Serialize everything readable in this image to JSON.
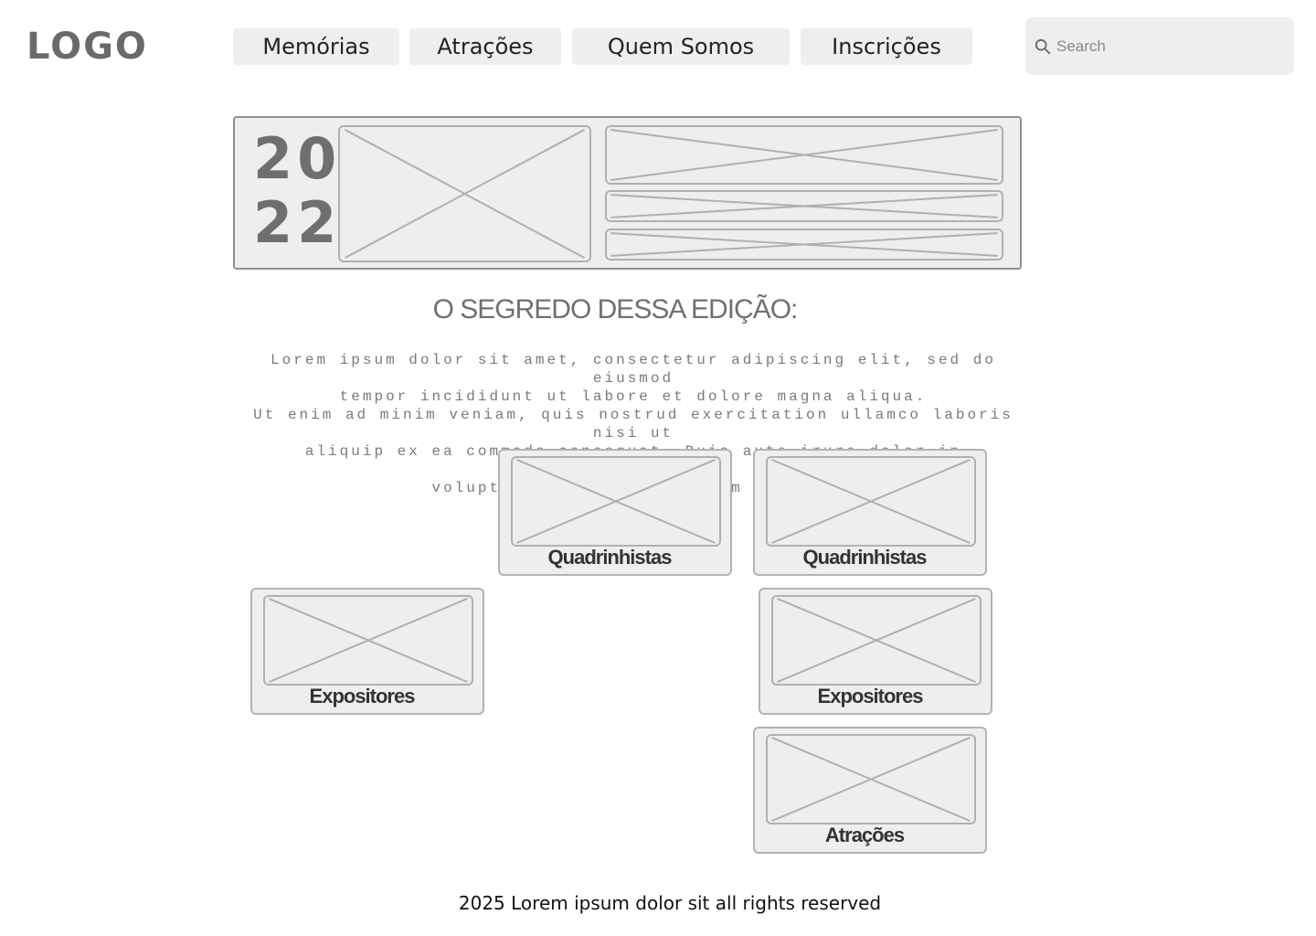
{
  "header": {
    "logo": "LOGO",
    "nav": [
      {
        "label": "Memórias"
      },
      {
        "label": "Atrações"
      },
      {
        "label": "Quem Somos"
      },
      {
        "label": "Inscrições"
      }
    ],
    "search": {
      "placeholder": "Search",
      "value": "",
      "icon": "search-icon"
    }
  },
  "hero": {
    "year_top": "20",
    "year_bottom": "22"
  },
  "main": {
    "headline": "O SEGREDO DESSA EDIÇÃO:",
    "paragraph_lines": [
      "Lorem ipsum dolor sit amet, consectetur adipiscing elit, sed do eiusmod",
      "tempor incididunt ut labore et dolore magna aliqua.",
      "Ut enim ad minim veniam, quis nostrud exercitation ullamco laboris nisi ut",
      "aliquip ex ea commodo consequat. Duis aute irure dolor in reprehenderit in",
      "voluptate velit esse cillum dolore."
    ],
    "cards": [
      {
        "label": "Quadrinhistas"
      },
      {
        "label": "Quadrinhistas"
      },
      {
        "label": "Expositores"
      },
      {
        "label": "Expositores"
      },
      {
        "label": "Atrações"
      }
    ]
  },
  "footer": {
    "text": "2025 Lorem ipsum dolor sit all rights reserved"
  }
}
